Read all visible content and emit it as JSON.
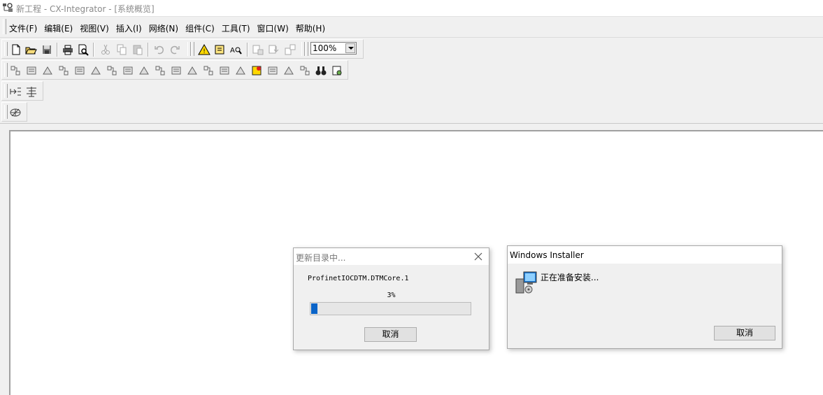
{
  "window": {
    "title": "新工程 - CX-Integrator - [系统概览]"
  },
  "menu": {
    "items": [
      "文件(F)",
      "编辑(E)",
      "视图(V)",
      "插入(I)",
      "网络(N)",
      "组件(C)",
      "工具(T)",
      "窗口(W)",
      "帮助(H)"
    ]
  },
  "toolbar": {
    "zoom_value": "100%",
    "row1_icons": [
      "new-file-icon",
      "open-folder-icon",
      "save-icon",
      "print-icon",
      "print-preview-icon",
      "cut-icon",
      "copy-icon",
      "paste-icon",
      "undo-icon",
      "redo-icon",
      "warning-icon",
      "notes-icon",
      "find-icon",
      "network-upload-icon",
      "network-download-icon",
      "network-compare-icon"
    ],
    "row2_icons": [
      "network-config-icon",
      "network-tree-icon",
      "wrench-icon",
      "node-icon",
      "grid-icon",
      "table-icon",
      "tools-icon",
      "document-icon",
      "module-icon",
      "module-settings-icon",
      "diamond-icon",
      "layers-icon",
      "unit-icon",
      "devices-icon",
      "monitor-icon",
      "alarm-icon",
      "error-icon",
      "io-table-icon",
      "transfer-icon",
      "binoculars-icon",
      "print-settings-icon"
    ],
    "row3_icons": [
      "indent-icon",
      "align-icon"
    ],
    "row4_icons": [
      "globe-network-icon"
    ]
  },
  "dialog_update": {
    "title": "更新目录中...",
    "item": "ProfinetIOCDTM.DTMCore.1",
    "percent_label": "3%",
    "progress": 0.03,
    "cancel": "取消"
  },
  "dialog_installer": {
    "title": "Windows Installer",
    "message": "正在准备安装...",
    "cancel": "取消"
  },
  "colors": {
    "progress_fill": "#0a64c8",
    "title_text": "#8a8a8a"
  }
}
